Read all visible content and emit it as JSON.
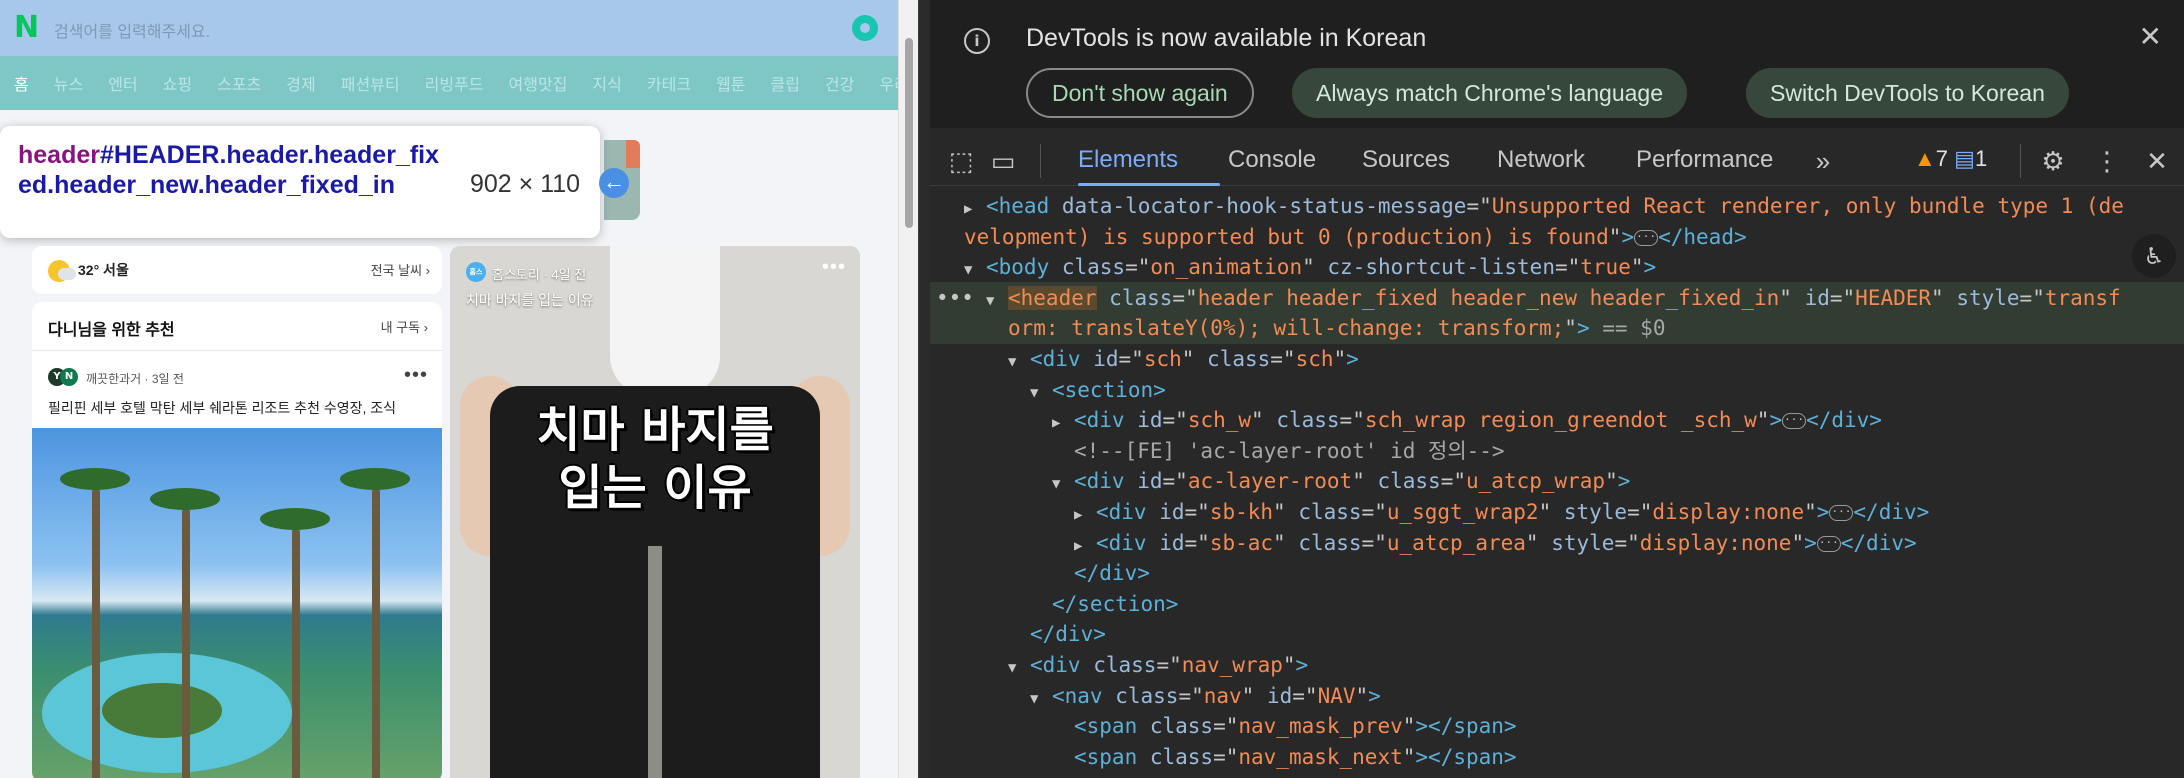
{
  "page": {
    "search_placeholder": "검색어를 입력해주세요.",
    "nav_items": [
      "홈",
      "뉴스",
      "엔터",
      "쇼핑",
      "스포츠",
      "경제",
      "패션뷰티",
      "리빙푸드",
      "여행맛집",
      "지식",
      "카테크",
      "웹툰",
      "클립",
      "건강",
      "우리동네"
    ],
    "tooltip": {
      "tag": "header",
      "selector": "#HEADER.header.header_fixed.header_new.header_fixed_in",
      "dimensions": "902 × 110"
    },
    "weather": {
      "temp_location": "32° 서울",
      "more": "전국 날씨 ›"
    },
    "recommend": {
      "title": "다니님을 위한 추천",
      "subscribe": "내 구독 ›",
      "source_meta": "깨끗한과거 · 3일 전",
      "headline": "필리핀 세부 호텔 막탄 세부 쉐라톤 리조트 추천 수영장, 조식"
    },
    "video": {
      "source_badge": "홈스",
      "source_meta": "홈스토리 · 4일 전",
      "title": "치마 바지를 입는 이유",
      "caption_line1": "치마 바지를",
      "caption_line2": "입는 이유"
    }
  },
  "devtools": {
    "infobar": {
      "message": "DevTools is now available in Korean",
      "btn_dont_show": "Don't show again",
      "btn_match": "Always match Chrome's language",
      "btn_switch": "Switch DevTools to Korean"
    },
    "tabs": [
      "Elements",
      "Console",
      "Sources",
      "Network",
      "Performance"
    ],
    "warnings_count": "7",
    "messages_count": "1",
    "tree": [
      {
        "indent": 0,
        "parts": [
          [
            "tw",
            "▶"
          ],
          [
            "tg",
            "<head "
          ],
          [
            "an",
            "data-locator-hook-status-message"
          ],
          [
            "pl",
            "=\""
          ],
          [
            "av",
            "Unsupported React renderer, only bundle type 1 (de"
          ]
        ]
      },
      {
        "indent": 0,
        "parts": [
          [
            "av",
            "velopment) is supported but 0 (production) is found"
          ],
          [
            "pl",
            "\""
          ],
          [
            "tg",
            ">"
          ],
          [
            "pill",
            ""
          ],
          [
            "tg",
            "</head>"
          ]
        ]
      },
      {
        "indent": 0,
        "parts": [
          [
            "tw",
            "▼"
          ],
          [
            "tg",
            "<body "
          ],
          [
            "an",
            "class"
          ],
          [
            "pl",
            "=\""
          ],
          [
            "av",
            "on_animation"
          ],
          [
            "pl",
            "\" "
          ],
          [
            "an",
            "cz-shortcut-listen"
          ],
          [
            "pl",
            "=\""
          ],
          [
            "av",
            "true"
          ],
          [
            "pl",
            "\""
          ],
          [
            "tg",
            ">"
          ]
        ]
      },
      {
        "indent": 1,
        "sel": true,
        "parts": [
          [
            "tw",
            "▼"
          ],
          [
            "hl",
            "<header"
          ],
          [
            "pl",
            " "
          ],
          [
            "an",
            "class"
          ],
          [
            "pl",
            "=\""
          ],
          [
            "av",
            "header header_fixed header_new header_fixed_in"
          ],
          [
            "pl",
            "\" "
          ],
          [
            "an",
            "id"
          ],
          [
            "pl",
            "=\""
          ],
          [
            "av",
            "HEADER"
          ],
          [
            "pl",
            "\" "
          ],
          [
            "an",
            "style"
          ],
          [
            "pl",
            "=\""
          ],
          [
            "av",
            "transf"
          ]
        ]
      },
      {
        "indent": 2,
        "sel": true,
        "parts": [
          [
            "av",
            "orm: translateY(0%); will-change: transform;"
          ],
          [
            "pl",
            "\""
          ],
          [
            "tg",
            ">"
          ],
          [
            "cm",
            " == $0"
          ]
        ]
      },
      {
        "indent": 2,
        "parts": [
          [
            "tw",
            "▼"
          ],
          [
            "tg",
            "<div "
          ],
          [
            "an",
            "id"
          ],
          [
            "pl",
            "=\""
          ],
          [
            "av",
            "sch"
          ],
          [
            "pl",
            "\" "
          ],
          [
            "an",
            "class"
          ],
          [
            "pl",
            "=\""
          ],
          [
            "av",
            "sch"
          ],
          [
            "pl",
            "\""
          ],
          [
            "tg",
            ">"
          ]
        ]
      },
      {
        "indent": 3,
        "parts": [
          [
            "tw",
            "▼"
          ],
          [
            "tg",
            "<section>"
          ]
        ]
      },
      {
        "indent": 4,
        "parts": [
          [
            "tw",
            "▶"
          ],
          [
            "tg",
            "<div "
          ],
          [
            "an",
            "id"
          ],
          [
            "pl",
            "=\""
          ],
          [
            "av",
            "sch_w"
          ],
          [
            "pl",
            "\" "
          ],
          [
            "an",
            "class"
          ],
          [
            "pl",
            "=\""
          ],
          [
            "av",
            "sch_wrap region_greendot _sch_w"
          ],
          [
            "pl",
            "\""
          ],
          [
            "tg",
            ">"
          ],
          [
            "pill",
            ""
          ],
          [
            "tg",
            "</div>"
          ]
        ]
      },
      {
        "indent": 4,
        "parts": [
          [
            "tw",
            " "
          ],
          [
            "cm",
            "<!--[FE] 'ac-layer-root' id 정의-->"
          ]
        ]
      },
      {
        "indent": 4,
        "parts": [
          [
            "tw",
            "▼"
          ],
          [
            "tg",
            "<div "
          ],
          [
            "an",
            "id"
          ],
          [
            "pl",
            "=\""
          ],
          [
            "av",
            "ac-layer-root"
          ],
          [
            "pl",
            "\" "
          ],
          [
            "an",
            "class"
          ],
          [
            "pl",
            "=\""
          ],
          [
            "av",
            "u_atcp_wrap"
          ],
          [
            "pl",
            "\""
          ],
          [
            "tg",
            ">"
          ]
        ]
      },
      {
        "indent": 5,
        "parts": [
          [
            "tw",
            "▶"
          ],
          [
            "tg",
            "<div "
          ],
          [
            "an",
            "id"
          ],
          [
            "pl",
            "=\""
          ],
          [
            "av",
            "sb-kh"
          ],
          [
            "pl",
            "\" "
          ],
          [
            "an",
            "class"
          ],
          [
            "pl",
            "=\""
          ],
          [
            "av",
            "u_sggt_wrap2"
          ],
          [
            "pl",
            "\" "
          ],
          [
            "an",
            "style"
          ],
          [
            "pl",
            "=\""
          ],
          [
            "av",
            "display:none"
          ],
          [
            "pl",
            "\""
          ],
          [
            "tg",
            ">"
          ],
          [
            "pill",
            ""
          ],
          [
            "tg",
            "</div>"
          ]
        ]
      },
      {
        "indent": 5,
        "parts": [
          [
            "tw",
            "▶"
          ],
          [
            "tg",
            "<div "
          ],
          [
            "an",
            "id"
          ],
          [
            "pl",
            "=\""
          ],
          [
            "av",
            "sb-ac"
          ],
          [
            "pl",
            "\" "
          ],
          [
            "an",
            "class"
          ],
          [
            "pl",
            "=\""
          ],
          [
            "av",
            "u_atcp_area"
          ],
          [
            "pl",
            "\" "
          ],
          [
            "an",
            "style"
          ],
          [
            "pl",
            "=\""
          ],
          [
            "av",
            "display:none"
          ],
          [
            "pl",
            "\""
          ],
          [
            "tg",
            ">"
          ],
          [
            "pill",
            ""
          ],
          [
            "tg",
            "</div>"
          ]
        ]
      },
      {
        "indent": 4,
        "parts": [
          [
            "tw",
            " "
          ],
          [
            "tg",
            "</div>"
          ]
        ]
      },
      {
        "indent": 3,
        "parts": [
          [
            "tw",
            " "
          ],
          [
            "tg",
            "</section>"
          ]
        ]
      },
      {
        "indent": 2,
        "parts": [
          [
            "tw",
            " "
          ],
          [
            "tg",
            "</div>"
          ]
        ]
      },
      {
        "indent": 2,
        "parts": [
          [
            "tw",
            "▼"
          ],
          [
            "tg",
            "<div "
          ],
          [
            "an",
            "class"
          ],
          [
            "pl",
            "=\""
          ],
          [
            "av",
            "nav_wrap"
          ],
          [
            "pl",
            "\""
          ],
          [
            "tg",
            ">"
          ]
        ]
      },
      {
        "indent": 3,
        "parts": [
          [
            "tw",
            "▼"
          ],
          [
            "tg",
            "<nav "
          ],
          [
            "an",
            "class"
          ],
          [
            "pl",
            "=\""
          ],
          [
            "av",
            "nav"
          ],
          [
            "pl",
            "\" "
          ],
          [
            "an",
            "id"
          ],
          [
            "pl",
            "=\""
          ],
          [
            "av",
            "NAV"
          ],
          [
            "pl",
            "\""
          ],
          [
            "tg",
            ">"
          ]
        ]
      },
      {
        "indent": 4,
        "parts": [
          [
            "tw",
            " "
          ],
          [
            "tg",
            "<span "
          ],
          [
            "an",
            "class"
          ],
          [
            "pl",
            "=\""
          ],
          [
            "av",
            "nav_mask_prev"
          ],
          [
            "pl",
            "\""
          ],
          [
            "tg",
            "></span>"
          ]
        ]
      },
      {
        "indent": 4,
        "parts": [
          [
            "tw",
            " "
          ],
          [
            "tg",
            "<span "
          ],
          [
            "an",
            "class"
          ],
          [
            "pl",
            "=\""
          ],
          [
            "av",
            "nav_mask_next"
          ],
          [
            "pl",
            "\""
          ],
          [
            "tg",
            "></span>"
          ]
        ]
      }
    ]
  }
}
